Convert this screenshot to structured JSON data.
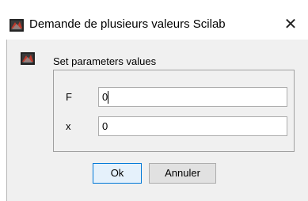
{
  "window": {
    "title": "Demande de plusieurs valeurs Scilab",
    "close_glyph": "✕",
    "app_icon": "scilab-icon"
  },
  "dialog": {
    "message": "Set parameters values",
    "icon": "scilab-icon",
    "fields": [
      {
        "label": "F",
        "value": "0"
      },
      {
        "label": "x",
        "value": "0"
      }
    ],
    "focused_field": "F"
  },
  "buttons": {
    "ok": "Ok",
    "cancel": "Annuler"
  },
  "colors": {
    "client_bg": "#f0f0f0",
    "default_button_border": "#0078d7",
    "default_button_bg": "#e5f1fb"
  }
}
